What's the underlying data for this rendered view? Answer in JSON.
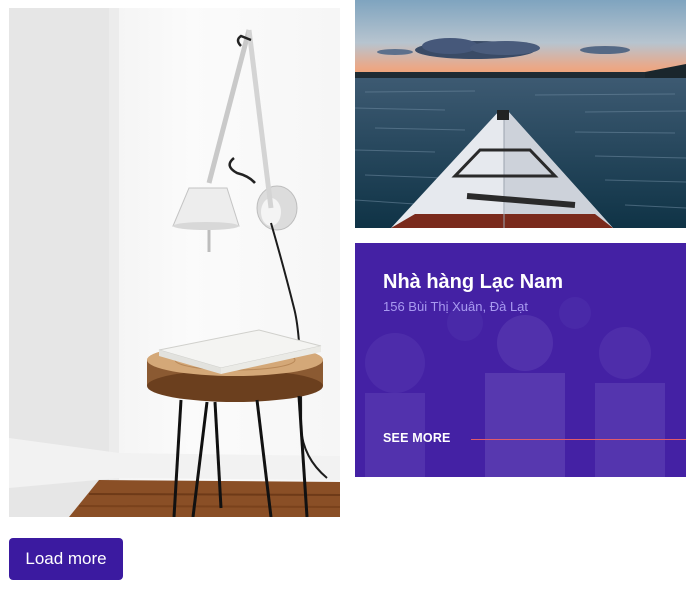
{
  "gallery": {
    "card": {
      "title": "Nhà hàng Lạc Nam",
      "address": "156 Bùi Thị Xuân, Đà Lạt",
      "see_more_label": "SEE MORE",
      "overlay_color": "#3c16a0",
      "accent_line_color": "#e05a6a"
    },
    "load_more_label": "Load more"
  },
  "colors": {
    "primary_button": "#3b1aa0",
    "subtitle": "#a89af0"
  }
}
